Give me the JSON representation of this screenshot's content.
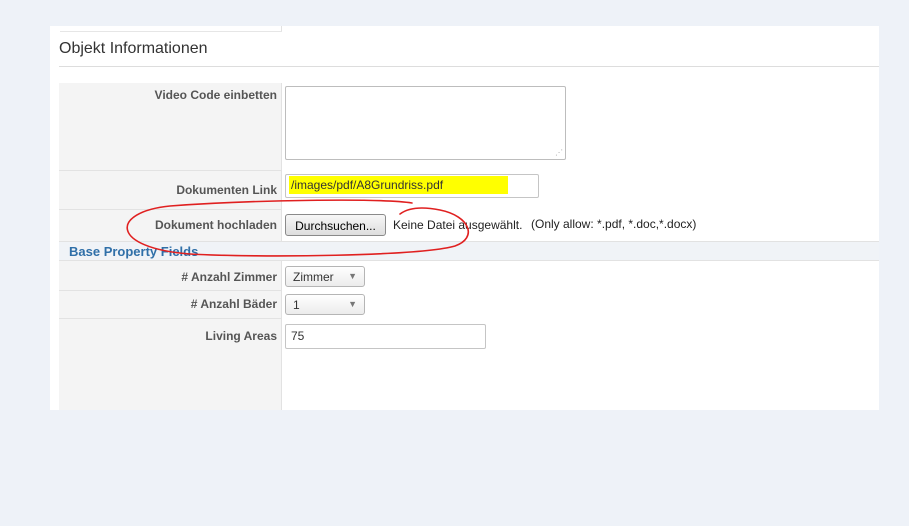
{
  "section": {
    "title": "Objekt Informationen"
  },
  "fields": {
    "video_code_label": "Video Code einbetten",
    "video_code_value": "",
    "doc_link_label": "Dokumenten Link",
    "doc_link_value": "/images/pdf/A8Grundriss.pdf",
    "upload_label": "Dokument hochladen",
    "browse_button": "Durchsuchen...",
    "file_status": "Keine Datei ausgewählt.",
    "allow_note": "(Only allow: *.pdf, *.doc,*.docx)"
  },
  "base_property": {
    "title": "Base Property Fields",
    "rooms_label": "# Anzahl Zimmer",
    "rooms_value": "Zimmer",
    "baths_label": "# Anzahl Bäder",
    "baths_value": "1",
    "living_label": "Living Areas",
    "living_value": "75"
  },
  "icons": {
    "dropdown": "chevron-down-icon",
    "resize": "resize-grip-icon"
  },
  "colors": {
    "highlight": "#ffff00",
    "annotation": "#e02020",
    "section_blue": "#2f6fa8"
  }
}
